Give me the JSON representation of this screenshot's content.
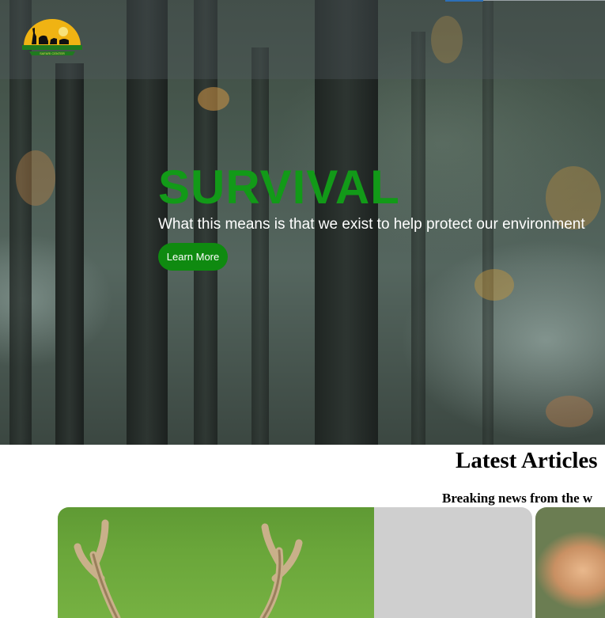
{
  "header": {
    "logo_text": "SAFARI CENTER"
  },
  "hero": {
    "title": "SURVIVAL",
    "subtitle": "What this means is that we exist to help protect our environment",
    "button_label": "Learn More"
  },
  "articles": {
    "title": "Latest Articles",
    "subtitle": "Breaking news from the w"
  },
  "colors": {
    "accent_green": "#0f8a10",
    "title_green": "#129a18"
  }
}
